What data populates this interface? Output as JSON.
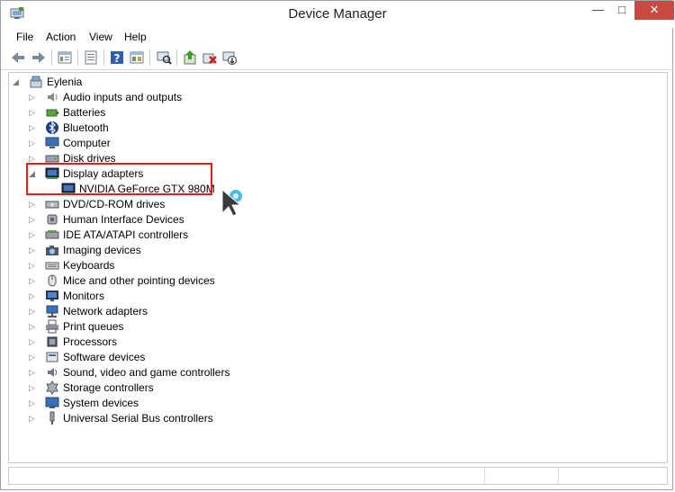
{
  "window": {
    "title": "Device Manager"
  },
  "menu": [
    "File",
    "Action",
    "View",
    "Help"
  ],
  "toolbar": {
    "icons": [
      "back-arrow-icon",
      "forward-arrow-icon",
      "show-hide-tree-icon",
      "properties-icon",
      "help-icon",
      "view-icon",
      "scan-hardware-icon",
      "update-driver-icon",
      "uninstall-icon",
      "disable-device-icon"
    ]
  },
  "tree": {
    "root": "Eylenia",
    "items": [
      {
        "label": "Audio inputs and outputs",
        "icon": "speaker-icon"
      },
      {
        "label": "Batteries",
        "icon": "battery-icon"
      },
      {
        "label": "Bluetooth",
        "icon": "bluetooth-icon"
      },
      {
        "label": "Computer",
        "icon": "computer-icon"
      },
      {
        "label": "Disk drives",
        "icon": "disk-drive-icon"
      },
      {
        "label": "Display adapters",
        "icon": "display-adapter-icon",
        "expanded": true,
        "children": [
          {
            "label": "NVIDIA GeForce GTX 980M",
            "icon": "display-adapter-icon"
          }
        ]
      },
      {
        "label": "DVD/CD-ROM drives",
        "icon": "dvd-drive-icon"
      },
      {
        "label": "Human Interface Devices",
        "icon": "hid-icon"
      },
      {
        "label": "IDE ATA/ATAPI controllers",
        "icon": "ide-controller-icon"
      },
      {
        "label": "Imaging devices",
        "icon": "camera-icon"
      },
      {
        "label": "Keyboards",
        "icon": "keyboard-icon"
      },
      {
        "label": "Mice and other pointing devices",
        "icon": "mouse-icon"
      },
      {
        "label": "Monitors",
        "icon": "monitor-icon"
      },
      {
        "label": "Network adapters",
        "icon": "network-adapter-icon"
      },
      {
        "label": "Print queues",
        "icon": "printer-icon"
      },
      {
        "label": "Processors",
        "icon": "processor-icon"
      },
      {
        "label": "Software devices",
        "icon": "software-device-icon"
      },
      {
        "label": "Sound, video and game controllers",
        "icon": "sound-icon"
      },
      {
        "label": "Storage controllers",
        "icon": "storage-controller-icon"
      },
      {
        "label": "System devices",
        "icon": "system-device-icon"
      },
      {
        "label": "Universal Serial Bus controllers",
        "icon": "usb-icon"
      }
    ]
  },
  "colors": {
    "highlight_border": "#e0201c",
    "close_button": "#c74b40"
  }
}
